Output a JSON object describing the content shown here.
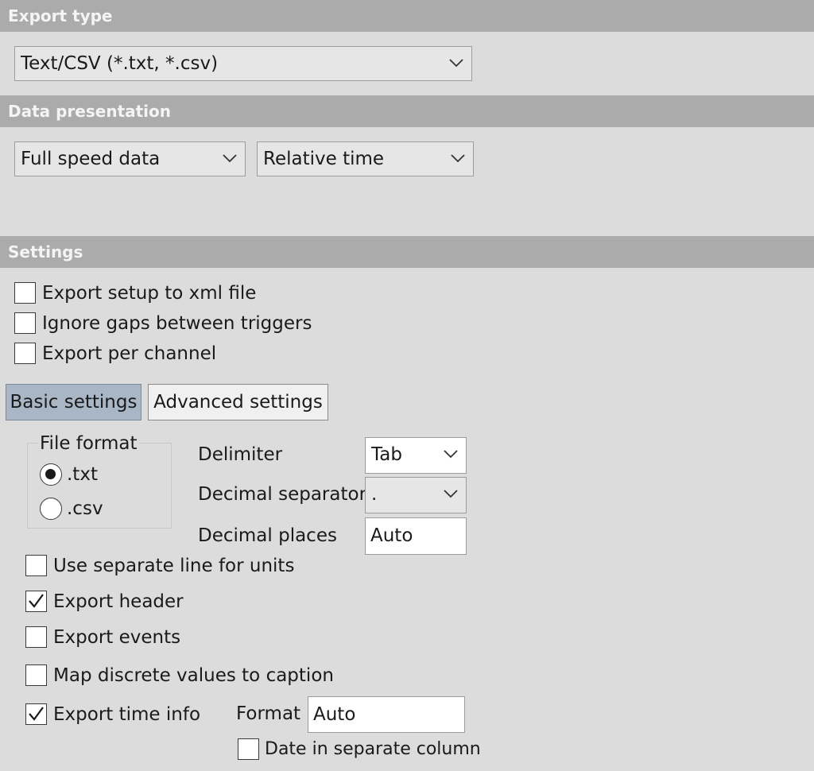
{
  "sections": {
    "export_type": "Export type",
    "data_presentation": "Data presentation",
    "settings": "Settings"
  },
  "export_type_select": {
    "value": "Text/CSV (*.txt, *.csv)"
  },
  "data_presentation": {
    "speed_select": "Full speed data",
    "time_select": "Relative time"
  },
  "settings_checkboxes": [
    {
      "label": "Export setup to xml file",
      "checked": false
    },
    {
      "label": "Ignore gaps between triggers",
      "checked": false
    },
    {
      "label": "Export per channel",
      "checked": false
    }
  ],
  "tabs": {
    "basic": "Basic settings",
    "advanced": "Advanced settings",
    "active": "basic"
  },
  "file_format": {
    "title": "File format",
    "options": [
      {
        "label": ".txt",
        "selected": true
      },
      {
        "label": ".csv",
        "selected": false
      }
    ]
  },
  "delimiter": {
    "label": "Delimiter",
    "value": "Tab"
  },
  "decimal_separator": {
    "label": "Decimal separator",
    "value": "."
  },
  "decimal_places": {
    "label": "Decimal places",
    "value": "Auto"
  },
  "basic_checkboxes": [
    {
      "label": "Use separate line for units",
      "checked": false
    },
    {
      "label": "Export header",
      "checked": true
    },
    {
      "label": "Export events",
      "checked": false
    },
    {
      "label": "Map discrete values to caption",
      "checked": false
    },
    {
      "label": "Export time info",
      "checked": true
    }
  ],
  "time_format": {
    "label": "Format",
    "value": "Auto"
  },
  "date_separate_column": {
    "label": "Date in separate column",
    "checked": false
  },
  "colors": {
    "background": "#dcdcdc",
    "section_header": "#ababab",
    "active_tab": "#a9b6c6"
  }
}
